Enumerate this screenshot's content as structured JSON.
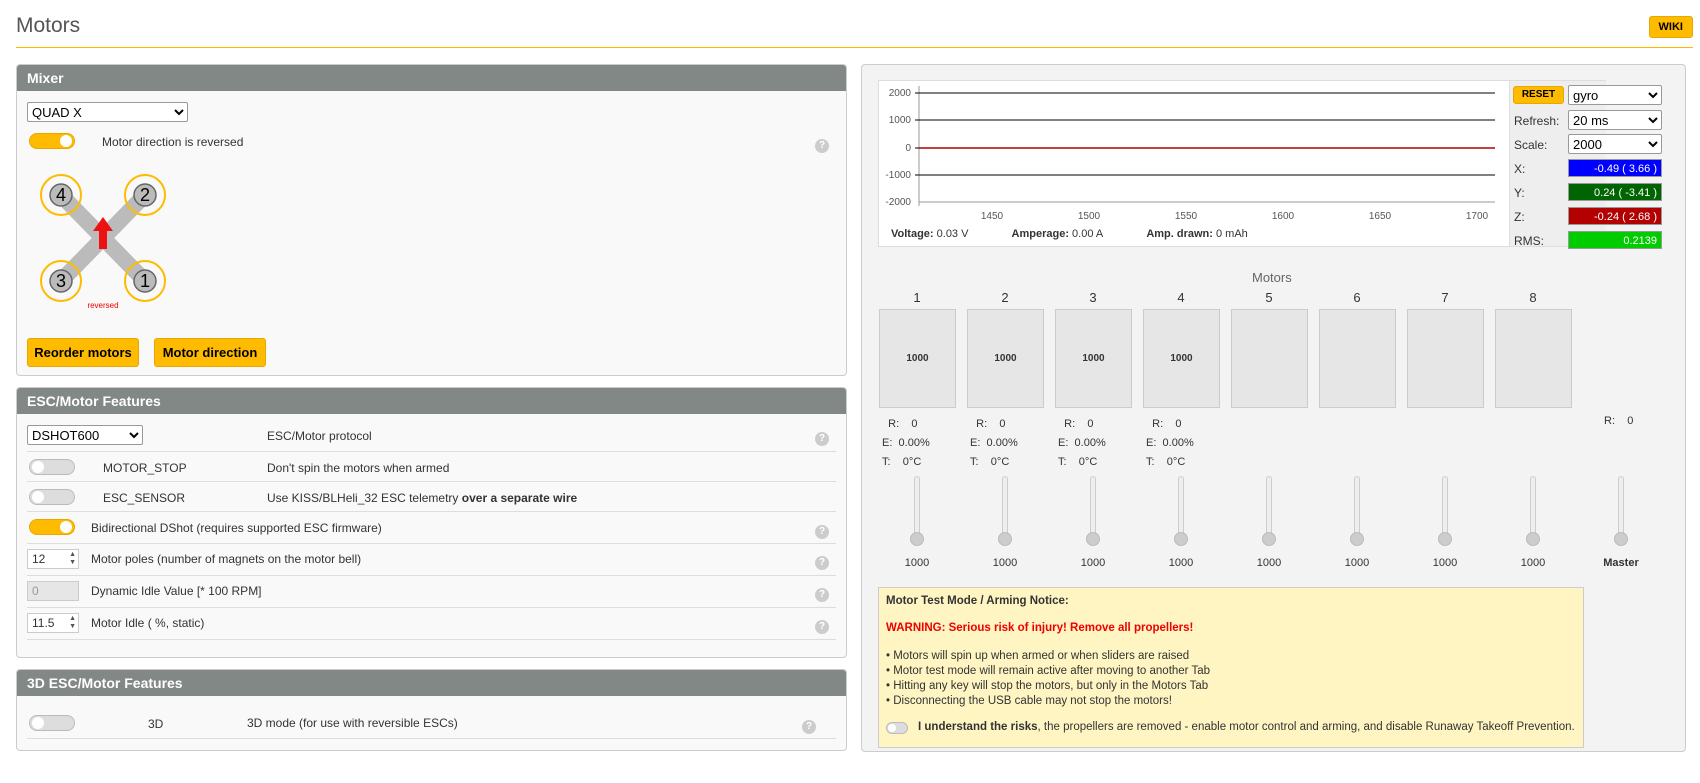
{
  "page": {
    "title": "Motors",
    "wiki": "WIKI"
  },
  "mixer": {
    "header": "Mixer",
    "selected": "QUAD X",
    "reversed_label": "Motor direction is reversed",
    "reversed_on": true,
    "diagram_motors": [
      "4",
      "2",
      "3",
      "1"
    ],
    "diagram_note": "reversed",
    "reorder_button": "Reorder motors",
    "direction_button": "Motor direction"
  },
  "esc": {
    "header": "ESC/Motor Features",
    "protocol": "DSHOT600",
    "protocol_label": "ESC/Motor protocol",
    "motor_stop_name": "MOTOR_STOP",
    "motor_stop_desc": "Don't spin the motors when armed",
    "esc_sensor_name": "ESC_SENSOR",
    "esc_sensor_desc": "Use KISS/BLHeli_32 ESC telemetry",
    "esc_sensor_desc_bold": "over a separate wire",
    "bidir_label": "Bidirectional DShot (requires supported ESC firmware)",
    "motor_poles_value": "12",
    "motor_poles_label": "Motor poles (number of magnets on the motor bell)",
    "dyn_idle_value": "0",
    "dyn_idle_label": "Dynamic Idle Value [* 100 RPM]",
    "motor_idle_value": "11.5",
    "motor_idle_label": "Motor Idle ( %, static)"
  },
  "esc3d": {
    "header": "3D ESC/Motor Features",
    "name": "3D",
    "desc": "3D mode (for use with reversible ESCs)"
  },
  "sensor": {
    "reset": "RESET",
    "sensor_select": "gyro",
    "refresh_label": "Refresh:",
    "refresh_value": "20 ms",
    "scale_label": "Scale:",
    "scale_value": "2000",
    "x_label": "X:",
    "x_value": "-0.49 ( 3.66 )",
    "y_label": "Y:",
    "y_value": "0.24 ( -3.41 )",
    "z_label": "Z:",
    "z_value": "-0.24 ( 2.68 )",
    "rms_label": "RMS:",
    "rms_value": "0.2139",
    "y_ticks": [
      "2000",
      "1000",
      "0",
      "-1000",
      "-2000"
    ],
    "x_ticks": [
      "1450",
      "1500",
      "1550",
      "1600",
      "1650",
      "1700"
    ],
    "voltage_label": "Voltage:",
    "voltage_value": "0.03 V",
    "amperage_label": "Amperage:",
    "amperage_value": "0.00 A",
    "drawn_label": "Amp. drawn:",
    "drawn_value": "0 mAh",
    "colors": {
      "x": "#0000ff",
      "y": "#006400",
      "z": "#b30000",
      "rms": "#00cc00"
    }
  },
  "motors": {
    "title": "Motors",
    "numbers": [
      "1",
      "2",
      "3",
      "4",
      "5",
      "6",
      "7",
      "8"
    ],
    "bar_values": [
      "1000",
      "1000",
      "1000",
      "1000"
    ],
    "telemetry": [
      {
        "r_label": "R:",
        "r": "0",
        "e_label": "E:",
        "e": "0.00%",
        "t_label": "T:",
        "t": "0°C"
      },
      {
        "r_label": "R:",
        "r": "0",
        "e_label": "E:",
        "e": "0.00%",
        "t_label": "T:",
        "t": "0°C"
      },
      {
        "r_label": "R:",
        "r": "0",
        "e_label": "E:",
        "e": "0.00%",
        "t_label": "T:",
        "t": "0°C"
      },
      {
        "r_label": "R:",
        "r": "0",
        "e_label": "E:",
        "e": "0.00%",
        "t_label": "T:",
        "t": "0°C"
      }
    ],
    "master_r_label": "R:",
    "master_r": "0",
    "slider_values": [
      "1000",
      "1000",
      "1000",
      "1000",
      "1000",
      "1000",
      "1000",
      "1000"
    ],
    "master_label": "Master"
  },
  "notice": {
    "title": "Motor Test Mode / Arming Notice:",
    "warning": "WARNING: Serious risk of injury! Remove all propellers!",
    "bullets": [
      "• Motors will spin up when armed or when sliders are raised",
      "• Motor test mode will remain active after moving to another Tab",
      "• Hitting any key will stop the motors, but only in the Motors Tab",
      "• Disconnecting the USB cable may not stop the motors!"
    ],
    "understand_bold": "I understand the risks",
    "understand_rest": ", the propellers are removed - enable motor control and arming, and disable Runaway Takeoff Prevention."
  }
}
